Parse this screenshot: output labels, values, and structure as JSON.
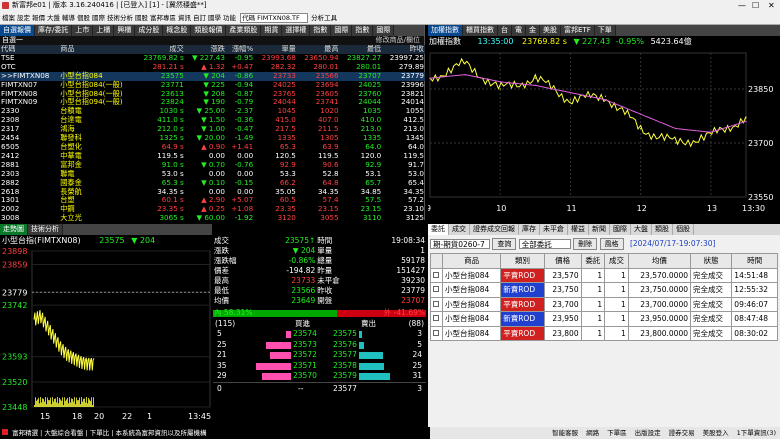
{
  "window": {
    "title": "新富邦e01 | 版本 3.16.240416 | [已登入] [1] - [冀然穩盛**]",
    "min": "—",
    "max": "☐",
    "close": "✕"
  },
  "menubar": {
    "items": [
      "檔案",
      "設定",
      "報價",
      "大盤",
      "輔導",
      "個股",
      "國際",
      "技術分析",
      "國股",
      "富邦專區",
      "資訊",
      "自訂",
      "國學",
      "功能"
    ],
    "code_value": "代碼 FIMTXN08.TF",
    "analysis": "分析工具"
  },
  "quote_panel": {
    "tabs": [
      "自選報價",
      "庫存/委託",
      "上市",
      "上櫃",
      "興櫃",
      "成分股",
      "概念股",
      "類股報價",
      "產業類股",
      "期貨",
      "選擇權",
      "指數",
      "國際",
      "指數",
      "國際"
    ],
    "group": "自選一",
    "edit_label": "修改商品/欄位",
    "headers": [
      "代碼",
      "商品",
      "成交",
      "漲跌",
      "漲幅%",
      "單量",
      "最高",
      "最低",
      "昨收"
    ],
    "rows": [
      {
        "code": "TSE",
        "name": "",
        "price": "23769.82 s",
        "chg": "▼ 227.43",
        "pct": "-0.95",
        "vol": "23993.68",
        "hi": "23650.94",
        "lo": "23827.27",
        "prev": "23997.25",
        "col": "g"
      },
      {
        "code": "OTC",
        "name": "",
        "price": "281.21 s",
        "chg": "▲ 1.32",
        "pct": "+0.47",
        "vol": "282.32",
        "hi": "280.01",
        "lo": "280.01",
        "prev": "279.89",
        "col": "r"
      },
      {
        "code": ">>FIMTXN08",
        "name": "小型台指084",
        "price": "23575",
        "chg": "▼ 204",
        "pct": "-0.86",
        "vol": "23733",
        "hi": "23566",
        "lo": "23707",
        "prev": "23779",
        "col": "g"
      },
      {
        "code": "FIMTXN07",
        "name": "小型台指084(一般)",
        "price": "23771",
        "chg": "▼ 225",
        "pct": "-0.94",
        "vol": "24025",
        "hi": "23694",
        "lo": "24025",
        "prev": "23996",
        "col": "g"
      },
      {
        "code": "FIMTXN08",
        "name": "小型台指084(一般)",
        "price": "23613",
        "chg": "▼ 208",
        "pct": "-0.87",
        "vol": "23765",
        "hi": "23605",
        "lo": "23760",
        "prev": "23821",
        "col": "g"
      },
      {
        "code": "FIMTXN09",
        "name": "小型台指094(一般)",
        "price": "23824",
        "chg": "▼ 190",
        "pct": "-0.79",
        "vol": "24044",
        "hi": "23741",
        "lo": "24044",
        "prev": "24014",
        "col": "g"
      },
      {
        "code": "2330",
        "name": "台積電",
        "price": "1030 s",
        "chg": "▼ 25.00",
        "pct": "-2.37",
        "vol": "1045",
        "hi": "1020",
        "lo": "1035",
        "prev": "1055",
        "col": "g"
      },
      {
        "code": "2308",
        "name": "台達電",
        "price": "411.0 s",
        "chg": "▼ 1.50",
        "pct": "-0.36",
        "vol": "415.0",
        "hi": "407.0",
        "lo": "410.0",
        "prev": "412.5",
        "col": "g"
      },
      {
        "code": "2317",
        "name": "鴻海",
        "price": "212.0 s",
        "chg": "▼ 1.00",
        "pct": "-0.47",
        "vol": "217.5",
        "hi": "211.5",
        "lo": "213.0",
        "prev": "213.0",
        "col": "g"
      },
      {
        "code": "2454",
        "name": "聯發科",
        "price": "1325 s",
        "chg": "▼ 20.00",
        "pct": "-1.49",
        "vol": "1335",
        "hi": "1305",
        "lo": "1335",
        "prev": "1345",
        "col": "g"
      },
      {
        "code": "6505",
        "name": "台塑化",
        "price": "64.9 s",
        "chg": "▲ 0.90",
        "pct": "+1.41",
        "vol": "65.3",
        "hi": "63.9",
        "lo": "64.0",
        "prev": "64.0",
        "col": "r"
      },
      {
        "code": "2412",
        "name": "中華電",
        "price": "119.5 s",
        "chg": "0.00",
        "pct": "0.00",
        "vol": "120.5",
        "hi": "119.5",
        "lo": "120.0",
        "prev": "119.5",
        "col": "w"
      },
      {
        "code": "2881",
        "name": "富邦金",
        "price": "91.0 s",
        "chg": "▼ 0.70",
        "pct": "-0.76",
        "vol": "92.9",
        "hi": "90.6",
        "lo": "92.9",
        "prev": "91.7",
        "col": "g"
      },
      {
        "code": "2303",
        "name": "聯電",
        "price": "53.0 s",
        "chg": "0.00",
        "pct": "0.00",
        "vol": "53.3",
        "hi": "52.8",
        "lo": "53.1",
        "prev": "53.0",
        "col": "w"
      },
      {
        "code": "2882",
        "name": "國泰金",
        "price": "65.3 s",
        "chg": "▼ 0.10",
        "pct": "-0.15",
        "vol": "66.2",
        "hi": "64.8",
        "lo": "65.7",
        "prev": "65.4",
        "col": "g"
      },
      {
        "code": "2618",
        "name": "長榮航",
        "price": "34.35 s",
        "chg": "0.00",
        "pct": "0.00",
        "vol": "35.05",
        "hi": "34.35",
        "lo": "34.85",
        "prev": "34.35",
        "col": "w"
      },
      {
        "code": "1301",
        "name": "台塑",
        "price": "60.1 s",
        "chg": "▲ 2.90",
        "pct": "+5.07",
        "vol": "60.5",
        "hi": "57.4",
        "lo": "57.5",
        "prev": "57.2",
        "col": "r"
      },
      {
        "code": "2002",
        "name": "中鋼",
        "price": "23.35 s",
        "chg": "▲ 0.25",
        "pct": "+1.08",
        "vol": "23.35",
        "hi": "23.15",
        "lo": "23.15",
        "prev": "23.10",
        "col": "r"
      },
      {
        "code": "3008",
        "name": "大立光",
        "price": "3065 s",
        "chg": "▼ 60.00",
        "pct": "-1.92",
        "vol": "3120",
        "hi": "3055",
        "lo": "3110",
        "prev": "3125",
        "col": "g"
      }
    ]
  },
  "index_panel": {
    "tabs": [
      "加權指數",
      "櫃買指數",
      "台",
      "電",
      "金",
      "美股",
      "富邦ETF",
      "下單"
    ],
    "name": "加權指數",
    "time": "13:35:00",
    "value": "23769.82 s",
    "chg": "▼ 227.43",
    "pct": "-0.95%",
    "volume": "5423.64億",
    "y_ticks": [
      "23850",
      "23700",
      "23550"
    ],
    "x_ticks": [
      "9",
      "10",
      "11",
      "12",
      "13",
      "13:30"
    ]
  },
  "chart_data": [
    {
      "type": "line",
      "title": "加權指數",
      "x": [
        9,
        9.5,
        10,
        10.5,
        11,
        11.5,
        12,
        12.5,
        13,
        13.5
      ],
      "series": [
        {
          "values": [
            23880,
            23920,
            23850,
            23880,
            23820,
            23830,
            23740,
            23700,
            23720,
            23770
          ]
        },
        {
          "values": [
            23880,
            23890,
            23870,
            23860,
            23840,
            23820,
            23780,
            23740,
            23730,
            23760
          ]
        }
      ],
      "ylim": [
        23550,
        23950
      ],
      "x_ticks": [
        "9",
        "10",
        "11",
        "12",
        "13",
        "13:30"
      ],
      "y_ticks": [
        23850,
        23700,
        23550
      ]
    },
    {
      "type": "line",
      "title": "小型台指084(FIMTXN08)",
      "x": [
        1,
        2,
        3,
        4,
        5,
        6,
        7,
        8,
        9,
        10
      ],
      "series": [
        {
          "values": [
            23700,
            23710,
            23680,
            23650,
            23620,
            23600,
            23590,
            23580,
            23575,
            23575
          ]
        }
      ],
      "ylim": [
        23448,
        23898
      ],
      "x_ticks": [
        "15",
        "18",
        "20",
        "22",
        "1",
        "13:45"
      ],
      "y_ticks": [
        23898,
        23859,
        23779,
        23742,
        23593,
        23520,
        23448
      ]
    }
  ],
  "tick_panel": {
    "tabs": [
      "走勢圖",
      "技術分析"
    ],
    "title": "小型台指(FIMTXN08)",
    "price": "23575",
    "chg": "▼ 204",
    "y_labels": [
      "23898",
      "23859",
      "23779",
      "23742",
      "23593",
      "23520",
      "23448"
    ],
    "x_labels": [
      "15",
      "18",
      "20",
      "22",
      "1",
      "13:45"
    ],
    "bottom_tabs": [
      "走勢",
      "明細",
      "價量表",
      "分價表",
      "分價圖",
      "分量表",
      "支撐壓力"
    ]
  },
  "detail_panel": {
    "rows": [
      [
        "成交",
        "23575↑",
        "時間",
        "19:08:34"
      ],
      [
        "漲跌",
        "▼ 204",
        "單量",
        "1"
      ],
      [
        "漲跌幅",
        "-0.86%",
        "總量",
        "59178"
      ],
      [
        "價差",
        "-194.82",
        "昨量",
        "151427"
      ],
      [
        "最高",
        "23733",
        "未平倉",
        "39230"
      ],
      [
        "最低",
        "23566",
        "昨收",
        "23779"
      ],
      [
        "均價",
        "23649",
        "開盤",
        "23707"
      ]
    ],
    "in_pct": "內 58.31%",
    "out_pct": "外 -41.69%",
    "bid_total": "(115)",
    "ask_total": "(88)",
    "bid_label": "買進",
    "ask_label": "賣出",
    "book": [
      [
        "5",
        "23574",
        "23575",
        "3"
      ],
      [
        "25",
        "23573",
        "23576",
        "5"
      ],
      [
        "21",
        "23572",
        "23577",
        "24"
      ],
      [
        "35",
        "23571",
        "23578",
        "25"
      ],
      [
        "29",
        "23570",
        "23579",
        "31"
      ]
    ],
    "bid_qty": [
      5,
      25,
      21,
      35,
      29
    ],
    "ask_qty": [
      3,
      5,
      24,
      25,
      31
    ],
    "foot": [
      "0",
      "--",
      "23577",
      "3"
    ]
  },
  "order_panel": {
    "tabs": [
      "委託",
      "成交",
      "證券成交回報",
      "庫存",
      "未平倉",
      "權益",
      "新聞",
      "國際",
      "大盤",
      "類股",
      "個股"
    ],
    "account": "期-期貨0260-7",
    "query_btn": "查詢",
    "filter": "全部委託",
    "delete_btn": "刪除",
    "risk_btn": "風格",
    "timestamp": "[2024/07/17-19:07:30]",
    "headers": [
      "",
      "商品",
      "類別",
      "價格",
      "委託",
      "成交",
      "均價",
      "狀態",
      "時間"
    ],
    "rows": [
      [
        "",
        "小型台指084",
        "平賣ROD",
        "23,570",
        "1",
        "1",
        "23,570.0000",
        "完全成交",
        "14:51:48"
      ],
      [
        "",
        "小型台指084",
        "新賣ROD",
        "23,750",
        "1",
        "1",
        "23,750.0000",
        "完全成交",
        "12:55:32"
      ],
      [
        "",
        "小型台指084",
        "平賣ROD",
        "23,700",
        "1",
        "1",
        "23,700.0000",
        "完全成交",
        "09:46:07"
      ],
      [
        "",
        "小型台指084",
        "新賣ROD",
        "23,950",
        "1",
        "1",
        "23,950.0000",
        "完全成交",
        "08:47:48"
      ],
      [
        "",
        "小型台指084",
        "平賣ROD",
        "23,800",
        "1",
        "1",
        "23,800.0000",
        "完全成交",
        "08:30:02"
      ]
    ]
  },
  "bottombar": {
    "text": "富邦精選 | 大盤綜合看盤 | 下單比 | 本系統為富邦資訊以及所屬機構"
  },
  "statusbar": {
    "items": [
      "智能客服",
      "網路",
      "下單區",
      "出版設定",
      "證券交易",
      "美股登入",
      "1下單資訊(3)"
    ]
  }
}
